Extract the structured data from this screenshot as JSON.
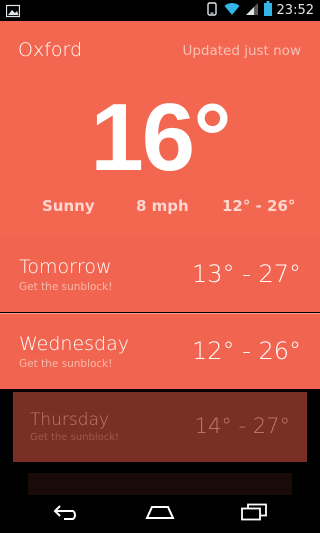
{
  "status_bar": {
    "time": "23:52"
  },
  "current": {
    "city": "Oxford",
    "updated": "Updated just now",
    "temperature": "16°",
    "condition": "Sunny",
    "wind": "8 mph",
    "range": "12° - 26°"
  },
  "forecast": [
    {
      "day": "Tomorrow",
      "note": "Get the sunblock!",
      "temps": "13° - 27°"
    },
    {
      "day": "Wednesday",
      "note": "Get the sunblock!",
      "temps": "12° - 26°"
    },
    {
      "day": "Thursday",
      "note": "Get the sunblock!",
      "temps": "14° - 27°"
    }
  ],
  "colors": {
    "accent": "#f36650",
    "row": "#f16550",
    "faded_row": "#7a2f24"
  },
  "icons": [
    "image-icon",
    "rotate-icon",
    "wifi-icon",
    "signal-icon",
    "battery-icon",
    "back-icon",
    "home-icon",
    "recent-apps-icon"
  ]
}
